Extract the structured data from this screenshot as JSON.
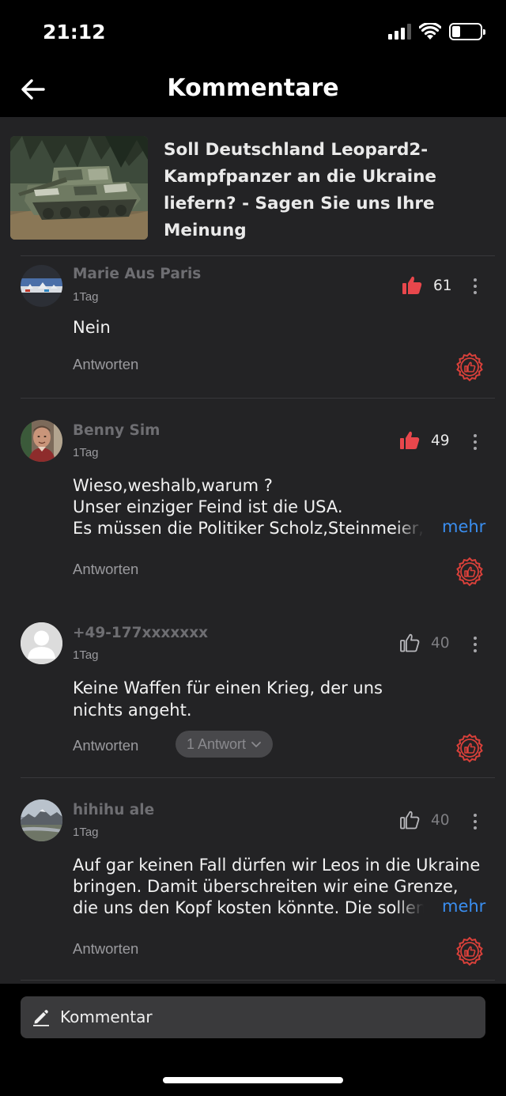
{
  "status_bar": {
    "time": "21:12",
    "battery_level": 0.3
  },
  "header": {
    "title": "Kommentare",
    "back_icon": "arrow-left-icon"
  },
  "article": {
    "title": "Soll Deutschland Leopard2-Kampfpanzer an die Ukraine liefern? - Sagen Sie uns Ihre Meinung"
  },
  "comments": [
    {
      "author": "Marie Aus Paris",
      "time": "1Tag",
      "likes": "61",
      "liked": true,
      "text": "Nein",
      "reply_label": "Antworten"
    },
    {
      "author": "Benny Sim",
      "time": "1Tag",
      "likes": "49",
      "liked": true,
      "text_lines": [
        "Wieso,weshalb,warum ?",
        "Unser einziger Feind ist die USA.",
        "Es müssen die Politiker Scholz,Steinmeier, "
      ],
      "more_label": "mehr",
      "reply_label": "Antworten"
    },
    {
      "author": "+49-177xxxxxxx",
      "time": "1Tag",
      "likes": "40",
      "liked": false,
      "text": "Keine Waffen für einen Krieg, der uns\nnichts angeht.",
      "reply_label": "Antworten",
      "replies_label": "1 Antwort"
    },
    {
      "author": "hihihu ale",
      "time": "1Tag",
      "likes": "40",
      "liked": false,
      "text_lines": [
        "Auf gar keinen Fall dürfen wir Leos in die Ukraine",
        "bringen.  Damit überschreiten wir eine Grenze,",
        "die uns den Kopf kosten könnte. Die sollen "
      ],
      "more_label": "mehr",
      "reply_label": "Antworten"
    }
  ],
  "footer": {
    "comment_placeholder": "Kommentar"
  },
  "colors": {
    "accent_blue": "#3a8ef0",
    "like_red": "#e8474c",
    "badge_red": "#d9403a",
    "surface": "#232325"
  }
}
